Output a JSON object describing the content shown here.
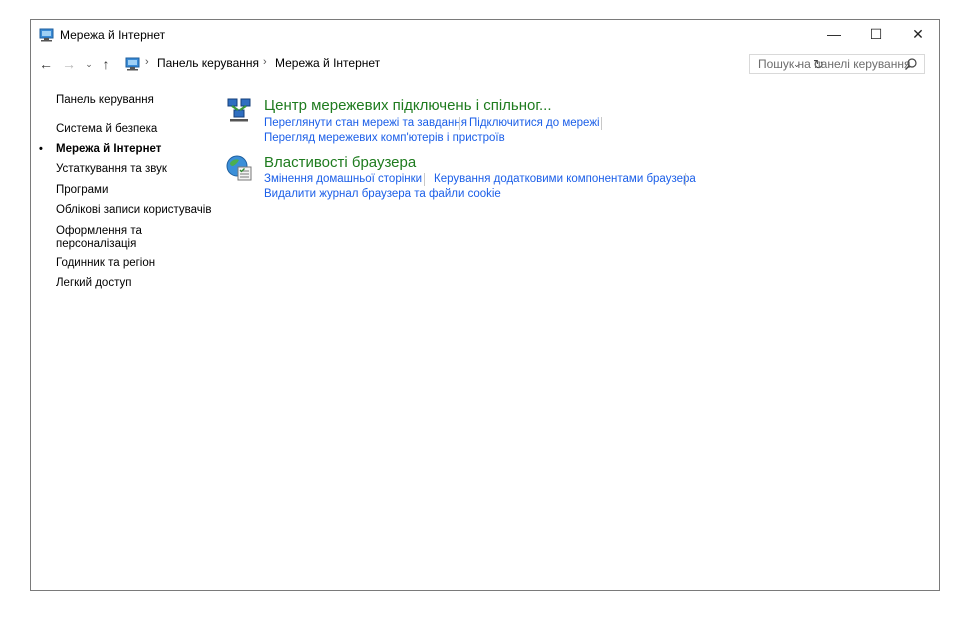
{
  "window": {
    "title": "Мережа й Інтернет",
    "controls": {
      "minimize": "—",
      "maximize": "☐",
      "close": "✕"
    }
  },
  "address_bar": {
    "breadcrumbs": [
      "Панель керування",
      "Мережа й Інтернет"
    ],
    "search_placeholder": "Пошук на панелі керування"
  },
  "sidebar": {
    "items": [
      {
        "label": "Панель керування",
        "active": false
      },
      {
        "label": "Система й безпека",
        "active": false
      },
      {
        "label": "Мережа й Інтернет",
        "active": true
      },
      {
        "label": "Устаткування та звук",
        "active": false
      },
      {
        "label": "Програми",
        "active": false
      },
      {
        "label": "Облікові записи користувачів",
        "active": false
      },
      {
        "label": "Оформлення та",
        "active": false
      },
      {
        "label": "персоналізація",
        "active": false
      },
      {
        "label": "Годинник та регіон",
        "active": false
      },
      {
        "label": "Легкий доступ",
        "active": false
      }
    ]
  },
  "categories": [
    {
      "title": "Центр мережевих підключень і спільног...",
      "icon": "network-center-icon",
      "links": [
        "Переглянути стан мережі та завдання",
        "Підключитися до мережі",
        "Перегляд мережевих комп'ютерів і пристроїв"
      ]
    },
    {
      "title": "Властивості браузера",
      "icon": "internet-options-icon",
      "links": [
        "Змінення домашньої сторінки",
        "Керування додатковими компонентами браузера",
        "Видалити журнал браузера та файли cookie"
      ]
    }
  ],
  "colors": {
    "link": "#1a5ee8",
    "category_title": "#1e7b1e",
    "annotation_arrow": "#e02020"
  }
}
